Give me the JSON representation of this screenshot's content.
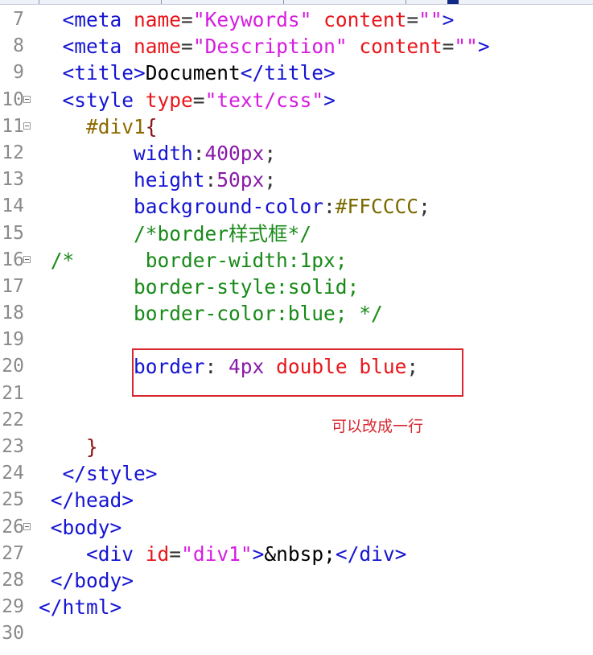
{
  "lines": [
    {
      "n": "7",
      "fold": false,
      "tokens": [
        [
          "sp",
          "  "
        ],
        [
          "tag",
          "<meta "
        ],
        [
          "attr",
          "name"
        ],
        [
          "pun",
          "="
        ],
        [
          "str",
          "\"Keywords\""
        ],
        [
          "sp",
          " "
        ],
        [
          "attr",
          "content"
        ],
        [
          "pun",
          "="
        ],
        [
          "str",
          "\"\""
        ],
        [
          "tag",
          ">"
        ]
      ]
    },
    {
      "n": "8",
      "fold": false,
      "tokens": [
        [
          "sp",
          "  "
        ],
        [
          "tag",
          "<meta "
        ],
        [
          "attr",
          "name"
        ],
        [
          "pun",
          "="
        ],
        [
          "str",
          "\"Description\""
        ],
        [
          "sp",
          " "
        ],
        [
          "attr",
          "content"
        ],
        [
          "pun",
          "="
        ],
        [
          "str",
          "\"\""
        ],
        [
          "tag",
          ">"
        ]
      ]
    },
    {
      "n": "9",
      "fold": false,
      "tokens": [
        [
          "sp",
          "  "
        ],
        [
          "tag",
          "<title>"
        ],
        [
          "text",
          "Document"
        ],
        [
          "tag",
          "</title>"
        ]
      ]
    },
    {
      "n": "10",
      "fold": true,
      "tokens": [
        [
          "sp",
          "  "
        ],
        [
          "tag",
          "<style "
        ],
        [
          "attr",
          "type"
        ],
        [
          "pun",
          "="
        ],
        [
          "str",
          "\"text/css\""
        ],
        [
          "tag",
          ">"
        ]
      ]
    },
    {
      "n": "11",
      "fold": true,
      "tokens": [
        [
          "sp",
          "    "
        ],
        [
          "sel",
          "#div1"
        ],
        [
          "brace",
          "{"
        ]
      ]
    },
    {
      "n": "12",
      "fold": false,
      "tokens": [
        [
          "sp",
          "        "
        ],
        [
          "prop",
          "width"
        ],
        [
          "pun",
          ":"
        ],
        [
          "num",
          "400px"
        ],
        [
          "pun",
          ";"
        ]
      ]
    },
    {
      "n": "13",
      "fold": false,
      "tokens": [
        [
          "sp",
          "        "
        ],
        [
          "prop",
          "height"
        ],
        [
          "pun",
          ":"
        ],
        [
          "num",
          "50px"
        ],
        [
          "pun",
          ";"
        ]
      ]
    },
    {
      "n": "14",
      "fold": false,
      "tokens": [
        [
          "sp",
          "        "
        ],
        [
          "prop",
          "background-color"
        ],
        [
          "pun",
          ":"
        ],
        [
          "color",
          "#FFCCCC"
        ],
        [
          "pun",
          ";"
        ]
      ]
    },
    {
      "n": "15",
      "fold": false,
      "tokens": [
        [
          "sp",
          "        "
        ],
        [
          "cmt",
          "/*border样式框*/"
        ]
      ]
    },
    {
      "n": "16",
      "fold": true,
      "tokens": [
        [
          "sp",
          " "
        ],
        [
          "cmt",
          "/*      border-width:1px;"
        ]
      ]
    },
    {
      "n": "17",
      "fold": false,
      "tokens": [
        [
          "sp",
          "        "
        ],
        [
          "cmt",
          "border-style:solid;"
        ]
      ]
    },
    {
      "n": "18",
      "fold": false,
      "tokens": [
        [
          "sp",
          "        "
        ],
        [
          "cmt",
          "border-color:blue; */"
        ]
      ]
    },
    {
      "n": "19",
      "fold": false,
      "tokens": []
    },
    {
      "n": "20",
      "fold": false,
      "tokens": [
        [
          "sp",
          "        "
        ],
        [
          "prop",
          "border"
        ],
        [
          "pun",
          ": "
        ],
        [
          "num",
          "4px "
        ],
        [
          "val",
          "double blue"
        ],
        [
          "pun",
          ";"
        ]
      ]
    },
    {
      "n": "21",
      "fold": false,
      "tokens": []
    },
    {
      "n": "22",
      "fold": false,
      "tokens": []
    },
    {
      "n": "23",
      "fold": false,
      "tokens": [
        [
          "sp",
          "    "
        ],
        [
          "brace",
          "}"
        ]
      ]
    },
    {
      "n": "24",
      "fold": false,
      "tokens": [
        [
          "sp",
          "  "
        ],
        [
          "tag",
          "</style>"
        ]
      ]
    },
    {
      "n": "25",
      "fold": false,
      "tokens": [
        [
          "sp",
          " "
        ],
        [
          "tag",
          "</head>"
        ]
      ]
    },
    {
      "n": "26",
      "fold": true,
      "tokens": [
        [
          "sp",
          " "
        ],
        [
          "tag",
          "<body>"
        ]
      ]
    },
    {
      "n": "27",
      "fold": false,
      "tokens": [
        [
          "sp",
          "    "
        ],
        [
          "tag",
          "<div "
        ],
        [
          "attr",
          "id"
        ],
        [
          "pun",
          "="
        ],
        [
          "str",
          "\"div1\""
        ],
        [
          "tag",
          ">"
        ],
        [
          "text",
          "&nbsp;"
        ],
        [
          "tag",
          "</div>"
        ]
      ]
    },
    {
      "n": "28",
      "fold": false,
      "tokens": [
        [
          "sp",
          " "
        ],
        [
          "tag",
          "</body>"
        ]
      ]
    },
    {
      "n": "29",
      "fold": false,
      "tokens": [
        [
          "tag",
          "</html>"
        ]
      ]
    },
    {
      "n": "30",
      "fold": false,
      "tokens": []
    }
  ],
  "annotation": "可以改成一行",
  "colors": {
    "tag": "#1414d2",
    "attr": "#e8151a",
    "string": "#d61ce0",
    "comment": "#188a18",
    "highlight": "#d8262e"
  }
}
